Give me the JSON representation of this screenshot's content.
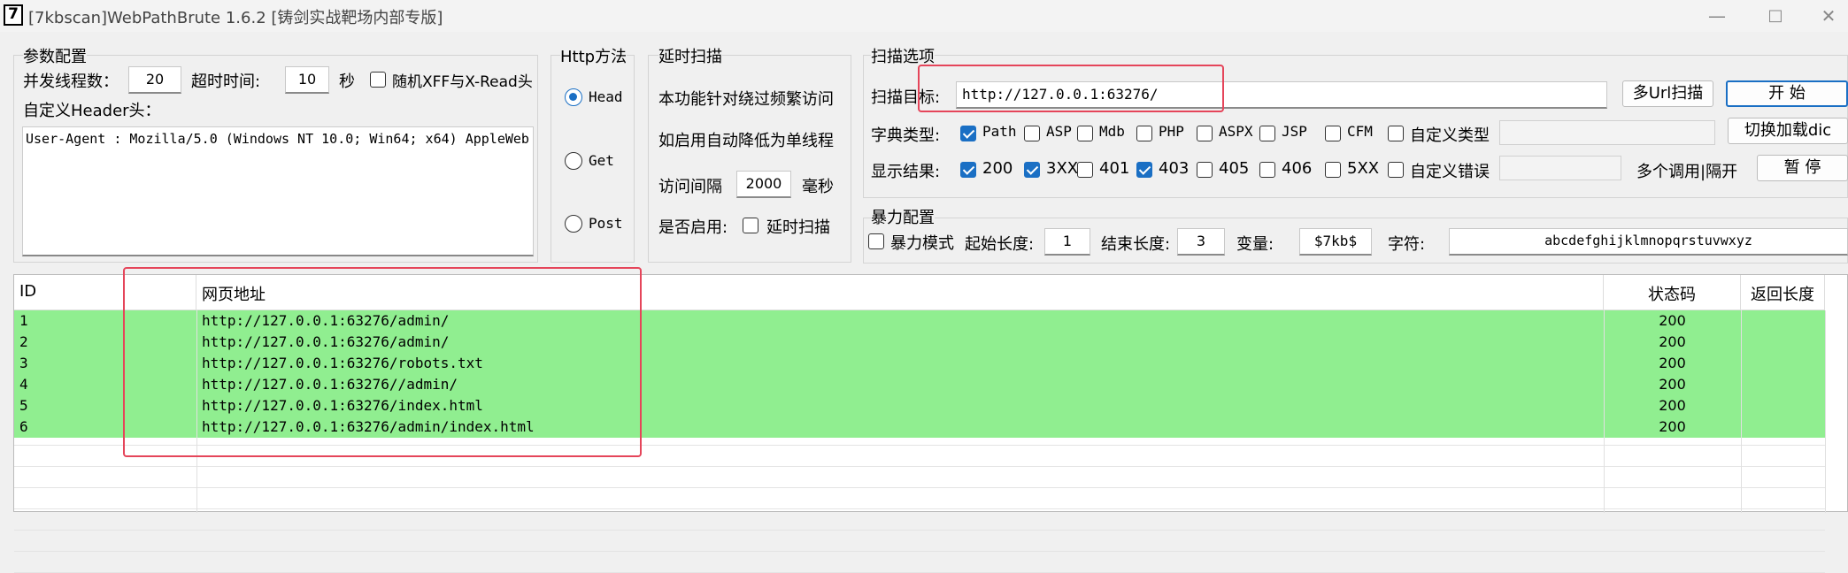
{
  "window": {
    "icon_glyph": "7",
    "title": "[7kbscan]WebPathBrute 1.6.2 [铸剑实战靶场内部专版]",
    "controls": [
      "—",
      "□",
      "✕"
    ]
  },
  "params": {
    "group_title": "参数配置",
    "threads_label": "并发线程数：",
    "threads_value": "20",
    "timeout_label": "超时时间:",
    "timeout_value": "10",
    "timeout_unit": "秒",
    "random_xff_label": "随机XFF与X-Read头",
    "random_xff_checked": false,
    "header_label": "自定义Header头：",
    "header_value": "User-Agent : Mozilla/5.0 (Windows NT 10.0; Win64; x64) AppleWeb"
  },
  "http": {
    "group_title": "Http方法",
    "methods": [
      {
        "label": "Head",
        "selected": true
      },
      {
        "label": "Get",
        "selected": false
      },
      {
        "label": "Post",
        "selected": false
      }
    ]
  },
  "delay": {
    "group_title": "延时扫描",
    "desc1": "本功能针对绕过频繁访问",
    "desc2": "如启用自动降低为单线程",
    "interval_label": "访问间隔",
    "interval_value": "2000",
    "interval_unit": "毫秒",
    "enable_label": "是否启用:",
    "enable_cb_label": "延时扫描",
    "enable_checked": false
  },
  "scan": {
    "group_title": "扫描选项",
    "target_label": "扫描目标:",
    "target_value": "http://127.0.0.1:63276/",
    "multi_url_button": "多Url扫描",
    "start_button": "开 始",
    "dict_label": "字典类型:",
    "dict_types": [
      {
        "label": "Path",
        "checked": true
      },
      {
        "label": "ASP",
        "checked": false
      },
      {
        "label": "Mdb",
        "checked": false
      },
      {
        "label": "PHP",
        "checked": false
      },
      {
        "label": "ASPX",
        "checked": false
      },
      {
        "label": "JSP",
        "checked": false
      },
      {
        "label": "CFM",
        "checked": false
      },
      {
        "label": "自定义类型",
        "checked": false
      }
    ],
    "switch_dict_button": "切换加载dic",
    "show_label": "显示结果:",
    "show_codes": [
      {
        "label": "200",
        "checked": true
      },
      {
        "label": "3XX",
        "checked": true
      },
      {
        "label": "401",
        "checked": false
      },
      {
        "label": "403",
        "checked": true
      },
      {
        "label": "405",
        "checked": false
      },
      {
        "label": "406",
        "checked": false
      },
      {
        "label": "5XX",
        "checked": false
      },
      {
        "label": "自定义错误",
        "checked": false
      }
    ],
    "separator_label": "多个调用|隔开",
    "pause_button": "暂 停"
  },
  "brute": {
    "group_title": "暴力配置",
    "mode_label": "暴力模式",
    "mode_checked": false,
    "start_len_label": "起始长度:",
    "start_len_value": "1",
    "end_len_label": "结束长度:",
    "end_len_value": "3",
    "var_label": "变量:",
    "var_value": "$7kb$",
    "charset_label": "字符:",
    "charset_value": "abcdefghijklmnopqrstuvwxyz"
  },
  "results": {
    "columns": [
      "ID",
      "网页地址",
      "状态码",
      "返回长度"
    ],
    "rows": [
      {
        "id": "1",
        "url": "http://127.0.0.1:63276/admin/",
        "status": "200",
        "length": ""
      },
      {
        "id": "2",
        "url": "http://127.0.0.1:63276/admin/",
        "status": "200",
        "length": ""
      },
      {
        "id": "3",
        "url": "http://127.0.0.1:63276/robots.txt",
        "status": "200",
        "length": ""
      },
      {
        "id": "4",
        "url": "http://127.0.0.1:63276//admin/",
        "status": "200",
        "length": ""
      },
      {
        "id": "5",
        "url": "http://127.0.0.1:63276/index.html",
        "status": "200",
        "length": ""
      },
      {
        "id": "6",
        "url": "http://127.0.0.1:63276/admin/index.html",
        "status": "200",
        "length": ""
      }
    ],
    "row_color": "#90ee90"
  },
  "annotation_color": "#e5455a"
}
